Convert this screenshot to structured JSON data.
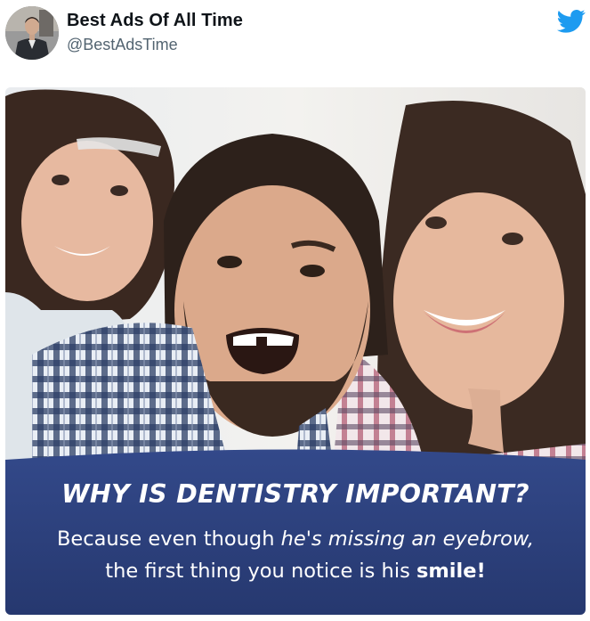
{
  "author": {
    "name": "Best Ads Of All Time",
    "handle": "@BestAdsTime"
  },
  "icons": {
    "brand": "twitter-bird-icon",
    "avatar": "man-in-suit-avatar"
  },
  "colors": {
    "twitter_blue": "#1d9bf0",
    "banner_blue": "#2b3f7e",
    "name_text": "#0f1419",
    "handle_text": "#536471"
  },
  "ad": {
    "headline": "WHY IS DENTISTRY IMPORTANT?",
    "body_line1_a": "Because even though ",
    "body_line1_b": "he's missing an eyebrow,",
    "body_line2_a": "the first thing you notice is his ",
    "body_line2_b": "smile!"
  }
}
